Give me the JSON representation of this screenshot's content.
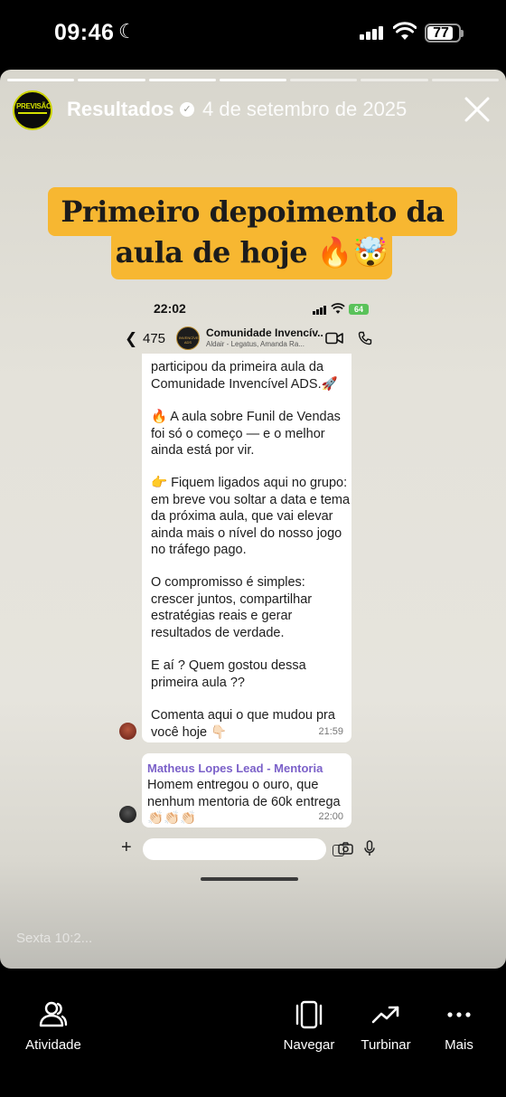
{
  "status_bar": {
    "time": "09:46",
    "battery": "77"
  },
  "story": {
    "account_name": "Resultados",
    "avatar_text": "PREVISÃO",
    "date": "4 de setembro de 2025",
    "progress": {
      "segments": 7,
      "completed": 4
    },
    "headline_line1": "Primeiro depoimento da",
    "headline_line2": "aula de hoje 🔥🤯",
    "caption": "Sexta 10:2..."
  },
  "embedded_chat": {
    "status_time": "22:02",
    "battery": "64",
    "back_count": "475",
    "group_name": "Comunidade Invencív...",
    "group_avatar_text": "INVENCÍVEL ADS",
    "group_members": "Aldair - Legatus, Amanda Ra...",
    "message1": {
      "paragraphs": [
        "participou da primeira aula da Comunidade Invencível ADS.🚀",
        "🔥 A aula sobre Funil de Vendas foi só o começo — e o melhor ainda está por vir.",
        "👉 Fiquem ligados aqui no grupo: em breve vou soltar a data e tema da próxima aula, que vai elevar ainda mais o nível do nosso jogo no tráfego pago.",
        "O compromisso é simples: crescer juntos, compartilhar estratégias reais e gerar resultados de verdade.",
        "E aí ? Quem gostou dessa primeira aula ??",
        "Comenta aqui o que mudou pra você hoje 👇🏻"
      ],
      "time": "21:59"
    },
    "message2": {
      "sender": "Matheus Lopes Lead - Mentoria",
      "text": "Homem entregou o ouro, que nenhum mentoria de 60k entrega 👏🏻👏🏻👏🏻",
      "time": "22:00"
    },
    "input_placeholder": ""
  },
  "bottom_nav": {
    "items": [
      {
        "label": "Atividade",
        "icon": "activity-people-icon"
      },
      {
        "label": "Navegar",
        "icon": "browse-cards-icon"
      },
      {
        "label": "Turbinar",
        "icon": "boost-trend-icon"
      },
      {
        "label": "Mais",
        "icon": "more-dots-icon"
      }
    ]
  },
  "colors": {
    "highlight": "#f7b731",
    "sender": "#7b61c9",
    "wa_battery": "#5ac25a"
  }
}
